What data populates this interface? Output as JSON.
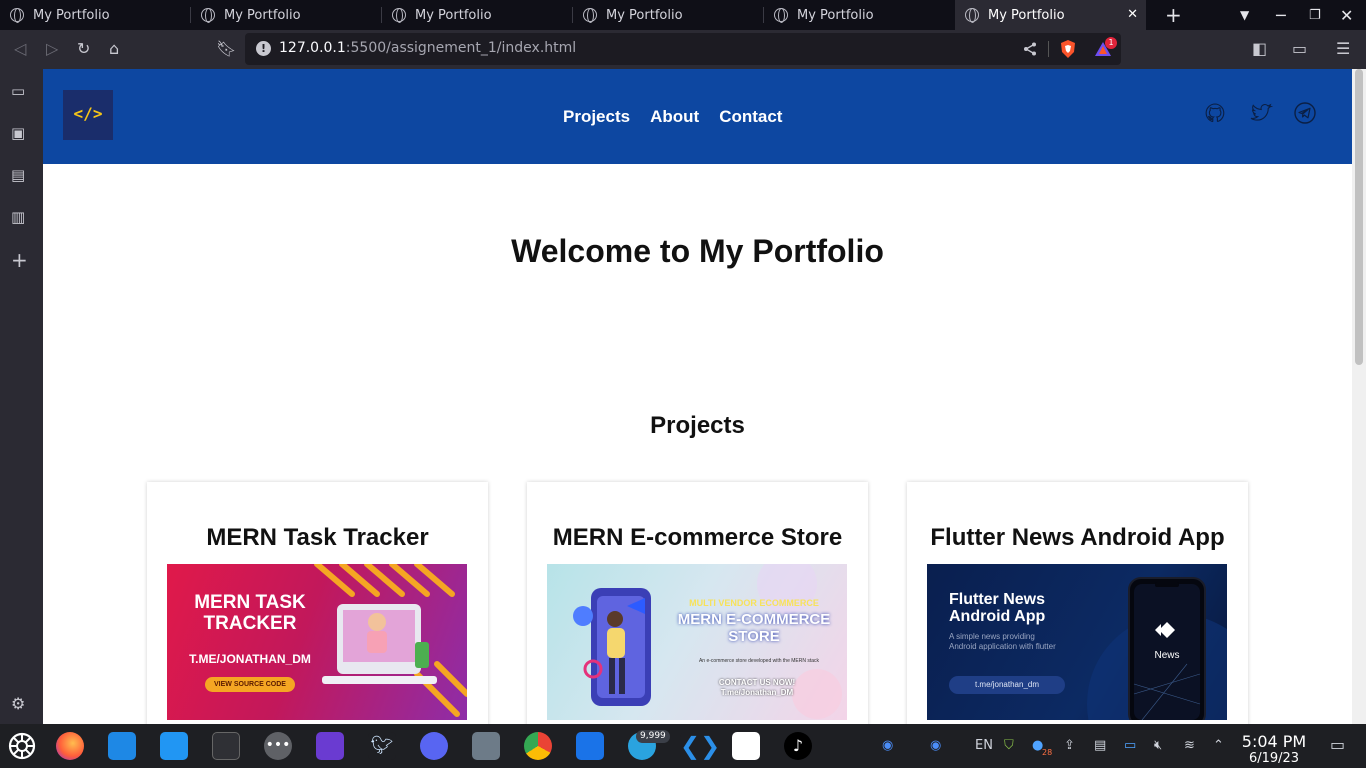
{
  "browser": {
    "tabs": [
      {
        "title": "My Portfolio"
      },
      {
        "title": "My Portfolio"
      },
      {
        "title": "My Portfolio"
      },
      {
        "title": "My Portfolio"
      },
      {
        "title": "My Portfolio"
      },
      {
        "title": "My Portfolio",
        "active": true
      }
    ],
    "url_host": "127.0.0.1",
    "url_rest": ":5500/assignement_1/index.html",
    "brave_badge": "1"
  },
  "site": {
    "logo_text": "</>",
    "nav": [
      "Projects",
      "About",
      "Contact"
    ],
    "social": [
      "github-icon",
      "twitter-icon",
      "telegram-icon"
    ],
    "welcome": "Welcome to My Portfolio",
    "projects_heading": "Projects",
    "projects": [
      {
        "title": "MERN Task Tracker",
        "image_lines": [
          "MERN TASK",
          "TRACKER"
        ],
        "image_handle": "T.ME/JONATHAN_DM",
        "image_button": "VIEW SOURCE CODE"
      },
      {
        "title": "MERN E-commerce Store",
        "image_kicker": "MULTI VENDOR ECOMMERCE",
        "image_lines": [
          "MERN E-COMMERCE",
          "STORE"
        ],
        "image_desc": "An e-commerce store developed with the MERN stack",
        "image_cta": "CONTACT US NOW!",
        "image_handle": "T.me/Jonathan_DM"
      },
      {
        "title": "Flutter News Android App",
        "image_lines": [
          "Flutter News",
          "Android App"
        ],
        "image_desc": "A simple news providing Android application with flutter",
        "image_handle": "t.me/jonathan_dm",
        "image_phone_label": "News"
      }
    ]
  },
  "taskbar": {
    "telegram_badge": "9,999",
    "lang": "EN",
    "calendar_badge": "28",
    "time": "5:04 PM",
    "date": "6/19/23"
  },
  "colors": {
    "header_bg": "#0d47a1",
    "logo_bg": "#1a2d6b",
    "logo_fg": "#f5c518"
  }
}
